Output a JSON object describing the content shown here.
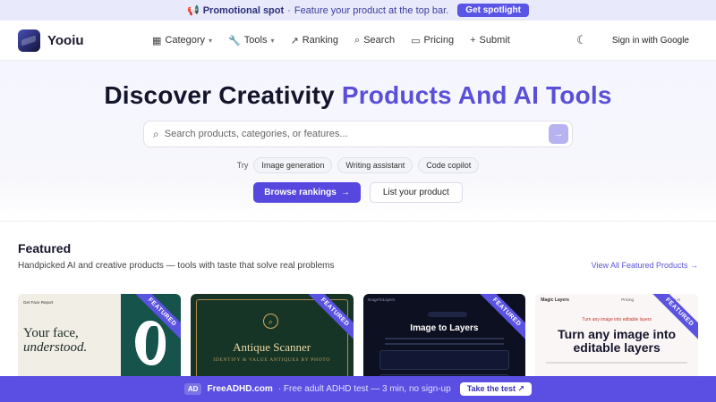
{
  "promo_bar": {
    "icon": "megaphone-icon",
    "title": "Promotional spot",
    "separator": "·",
    "text": "Feature your product at the top bar.",
    "cta": "Get spotlight"
  },
  "header": {
    "logo_text": "Yooiu",
    "nav": [
      {
        "label": "Category",
        "icon": "grid-icon",
        "caret": "⌄"
      },
      {
        "label": "Tools",
        "icon": "wrench-icon",
        "caret": "⌄"
      },
      {
        "label": "Ranking",
        "icon": "trending-icon"
      },
      {
        "label": "Search",
        "icon": "search-icon"
      },
      {
        "label": "Pricing",
        "icon": "card-icon"
      },
      {
        "label": "Submit",
        "icon": "plus-icon"
      }
    ],
    "theme_icon": "moon-icon",
    "sign_in": "Sign in with Google"
  },
  "hero": {
    "title_plain": "Discover Creativity",
    "title_accent": "Products And AI Tools",
    "search_placeholder": "Search products, categories, or features...",
    "try_label": "Try",
    "suggestions": [
      "Image generation",
      "Writing assistant",
      "Code copilot"
    ],
    "primary_button": "Browse rankings",
    "secondary_button": "List your product"
  },
  "featured": {
    "title": "Featured",
    "subtitle": "Handpicked AI and creative products — tools with taste that solve real problems",
    "view_all": "View All Featured Products →",
    "ribbon": "FEATURED",
    "cards": [
      {
        "brand": "Get Face Report",
        "headline_1": "Your face,",
        "headline_2": "understood."
      },
      {
        "title": "Antique Scanner",
        "subtitle": "IDENTIFY & VALUE ANTIQUES BY PHOTO"
      },
      {
        "topbar": "ImageToLayers",
        "title": "Image to Layers"
      },
      {
        "brand": "Magic Layers",
        "pricing": "Pricing",
        "sign_in": "Sign in",
        "tagline": "Turn any image into editable layers",
        "headline": "Turn any image into editable layers"
      }
    ]
  },
  "ad_bar": {
    "badge": "AD",
    "brand": "FreeADHD.com",
    "text": "· Free adult ADHD test — 3 min, no sign-up",
    "cta": "Take the test ↗"
  },
  "colors": {
    "accent": "#5b4fd8",
    "primary_button": "#5647de",
    "ad_bar": "#5a4fe2",
    "promo_bg": "#e8e9fb"
  }
}
